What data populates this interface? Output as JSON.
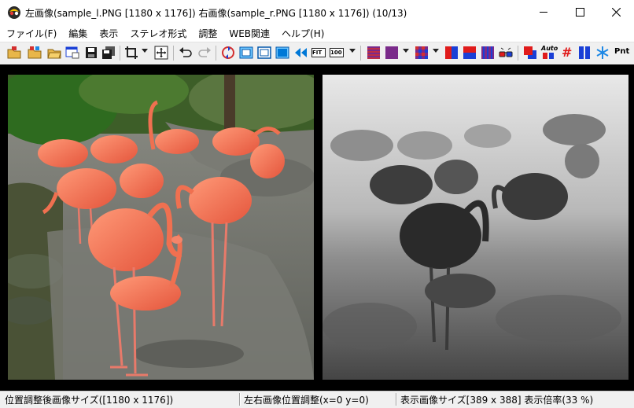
{
  "window": {
    "title": "左画像(sample_l.PNG [1180 x 1176]) 右画像(sample_r.PNG [1180 x 1176])  (10/13)",
    "minimize_icon": "minimize-icon",
    "maximize_icon": "maximize-icon",
    "close_icon": "close-icon"
  },
  "menu": [
    {
      "label": "ファイル(F)"
    },
    {
      "label": "編集"
    },
    {
      "label": "表示"
    },
    {
      "label": "ステレオ形式"
    },
    {
      "label": "調整"
    },
    {
      "label": "WEB関連"
    },
    {
      "label": "ヘルプ(H)"
    }
  ],
  "toolbar": {
    "fit_label": "FIT",
    "hundred_label": "100",
    "auto_label": "Auto",
    "pnt_label": "Pnt",
    "hash_label": "#",
    "colors": {
      "red": "#e01b1b",
      "blue": "#1a3fd6",
      "purple": "#7a2a8a",
      "cyan": "#0078d7",
      "teal": "#008b8b"
    }
  },
  "panes": {
    "left_label": "left-image-flamingos",
    "right_label": "right-image-depth-map"
  },
  "status": {
    "cell1": "位置調整後画像サイズ([1180 x 1176])",
    "cell2": "左右画像位置調整(x=0 y=0)",
    "cell3": "表示画像サイズ[389 x 388]  表示倍率(33 %)"
  }
}
